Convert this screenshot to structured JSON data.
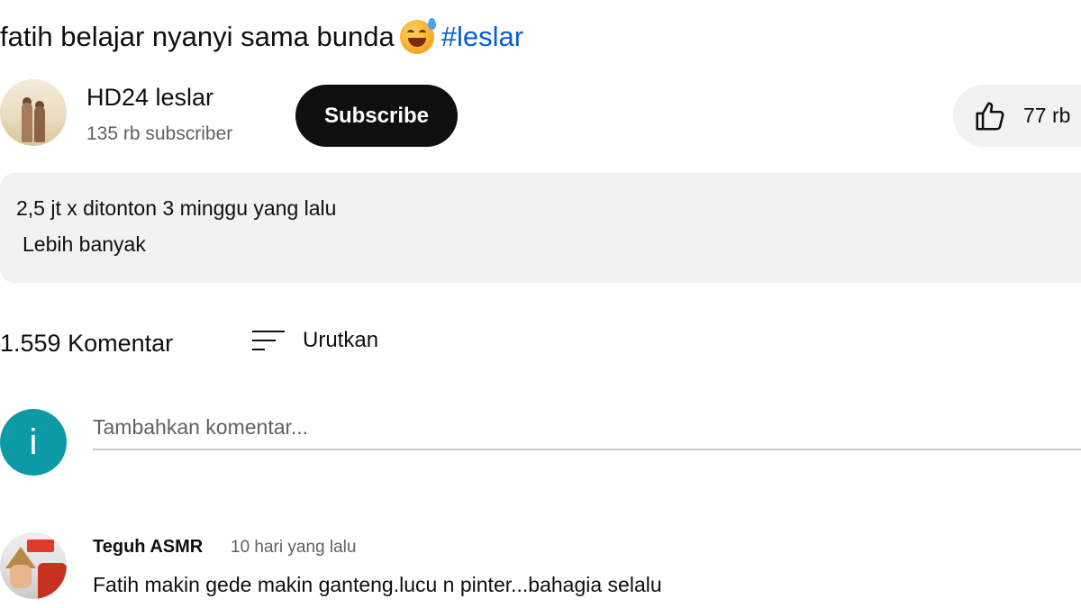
{
  "video": {
    "title": "fatih belajar nyanyi sama bunda",
    "title_emoji": "sweat-smile-emoji",
    "hashtag": "#leslar"
  },
  "channel": {
    "name": "HD24 leslar",
    "subscribers": "135 rb subscriber",
    "subscribe_label": "Subscribe",
    "like_count": "77 rb"
  },
  "description": {
    "meta": "2,5 jt x ditonton  3 minggu yang lalu",
    "more_label": "Lebih banyak"
  },
  "comments": {
    "count_label": "1.559 Komentar",
    "sort_label": "Urutkan",
    "add_placeholder": "Tambahkan komentar...",
    "my_avatar_letter": "i",
    "items": [
      {
        "author": "Teguh ASMR",
        "time": "10 hari yang lalu",
        "text": "Fatih makin gede makin ganteng.lucu n pinter...bahagia selalu"
      }
    ]
  },
  "colors": {
    "accent_link": "#065fd4",
    "subscribe_bg": "#0f0f0f",
    "chip_bg": "#f2f2f2",
    "my_avatar_bg": "#0c9aa6",
    "secondary_text": "#606060"
  },
  "icons": [
    "thumbs-up-icon",
    "sort-icon"
  ]
}
